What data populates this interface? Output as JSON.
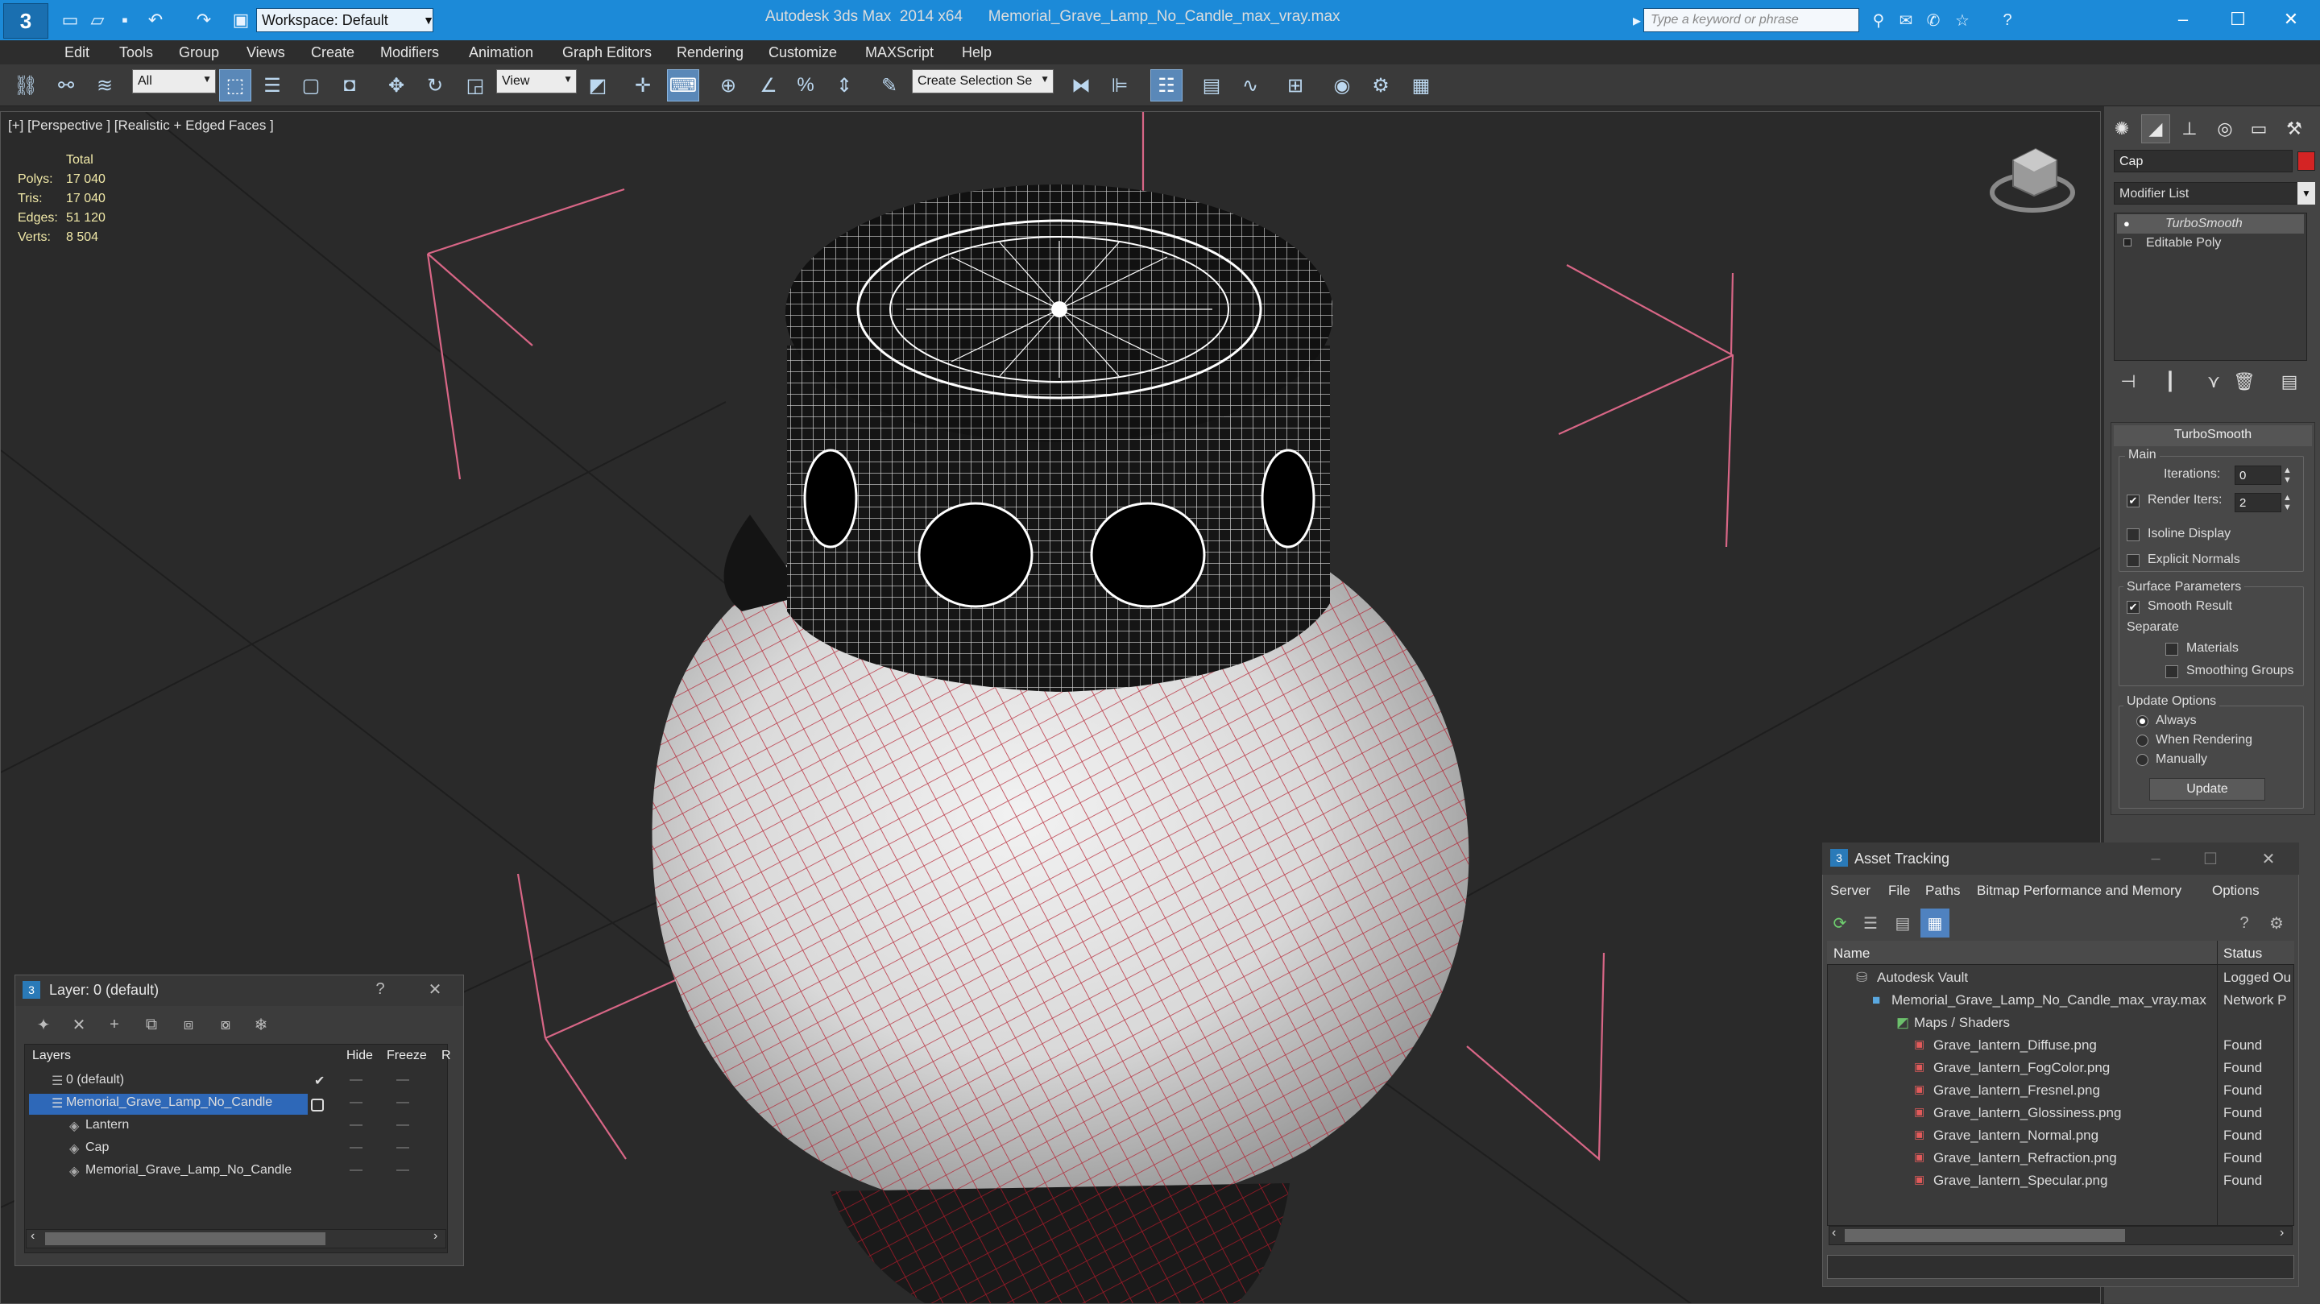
{
  "app": {
    "title": "Autodesk 3ds Max  2014 x64      Memorial_Grave_Lamp_No_Candle_max_vray.max",
    "workspace": "Workspace: Default",
    "search_placeholder": "Type a keyword or phrase"
  },
  "menu": [
    "Edit",
    "Tools",
    "Group",
    "Views",
    "Create",
    "Modifiers",
    "Animation",
    "Graph Editors",
    "Rendering",
    "Customize",
    "MAXScript",
    "Help"
  ],
  "toolbar": {
    "selection_filter": "All",
    "ref_coord": "View",
    "selection_set_placeholder": "Create Selection Se"
  },
  "viewport": {
    "label": "[+] [Perspective ] [Realistic + Edged Faces ]",
    "stats": {
      "header": "Total",
      "rows": [
        {
          "label": "Polys:",
          "value": "17 040"
        },
        {
          "label": "Tris:",
          "value": "17 040"
        },
        {
          "label": "Edges:",
          "value": "51 120"
        },
        {
          "label": "Verts:",
          "value": "8 504"
        }
      ]
    }
  },
  "command_panel": {
    "object_name": "Cap",
    "object_color": "#d42424",
    "modifier_list": "Modifier List",
    "stack": [
      {
        "label": "TurboSmooth",
        "selected": true
      },
      {
        "label": "Editable Poly",
        "selected": false
      }
    ],
    "turbosmooth": {
      "title": "TurboSmooth",
      "main_label": "Main",
      "iterations_label": "Iterations:",
      "iterations_value": "0",
      "render_iters_label": "Render Iters:",
      "render_iters_value": "2",
      "render_iters_checked": true,
      "isoline_label": "Isoline Display",
      "explicit_normals_label": "Explicit Normals",
      "surface_params_label": "Surface Parameters",
      "smooth_result_label": "Smooth Result",
      "separate_label": "Separate",
      "materials_label": "Materials",
      "smoothing_groups_label": "Smoothing Groups",
      "update_options_label": "Update Options",
      "update_always": "Always",
      "update_when_rendering": "When Rendering",
      "update_manually": "Manually",
      "update_button": "Update"
    }
  },
  "layer_dialog": {
    "title": "Layer: 0 (default)",
    "help": "?",
    "columns": [
      "Layers",
      "Hide",
      "Freeze",
      "R"
    ],
    "rows": [
      {
        "name": "0 (default)",
        "indent": 0,
        "selected": false
      },
      {
        "name": "Memorial_Grave_Lamp_No_Candle",
        "indent": 0,
        "selected": true
      },
      {
        "name": "Lantern",
        "indent": 1,
        "selected": false
      },
      {
        "name": "Cap",
        "indent": 1,
        "selected": false
      },
      {
        "name": "Memorial_Grave_Lamp_No_Candle",
        "indent": 1,
        "selected": false
      }
    ]
  },
  "asset_tracking": {
    "title": "Asset Tracking",
    "menu": [
      "Server",
      "File",
      "Paths",
      "Bitmap Performance and Memory",
      "Options"
    ],
    "columns": [
      "Name",
      "Status"
    ],
    "rows": [
      {
        "name": "Autodesk Vault",
        "status": "Logged Ou",
        "indent": 1
      },
      {
        "name": "Memorial_Grave_Lamp_No_Candle_max_vray.max",
        "status": "Network P",
        "indent": 2
      },
      {
        "name": "Maps / Shaders",
        "status": "",
        "indent": 3
      },
      {
        "name": "Grave_lantern_Diffuse.png",
        "status": "Found",
        "indent": 4
      },
      {
        "name": "Grave_lantern_FogColor.png",
        "status": "Found",
        "indent": 4
      },
      {
        "name": "Grave_lantern_Fresnel.png",
        "status": "Found",
        "indent": 4
      },
      {
        "name": "Grave_lantern_Glossiness.png",
        "status": "Found",
        "indent": 4
      },
      {
        "name": "Grave_lantern_Normal.png",
        "status": "Found",
        "indent": 4
      },
      {
        "name": "Grave_lantern_Refraction.png",
        "status": "Found",
        "indent": 4
      },
      {
        "name": "Grave_lantern_Specular.png",
        "status": "Found",
        "indent": 4
      }
    ]
  }
}
